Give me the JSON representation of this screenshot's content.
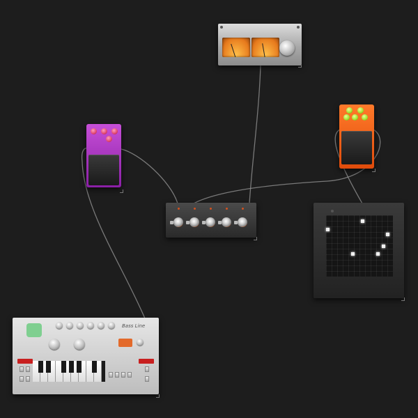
{
  "canvas": {
    "background": "#1d1d1d",
    "cable_color": "#8a8a8a"
  },
  "modules": {
    "vu_meter": {
      "icon": "vu-meter-icon",
      "meter_color": "#f08a24"
    },
    "pedal_purple": {
      "accent": "#b53bcc",
      "knob_color": "#e0466f"
    },
    "pedal_orange": {
      "accent": "#f26518",
      "knob_color": "#a3e12c"
    },
    "mixer": {
      "channel_count": 5,
      "knob_ring": "#b95a2a"
    },
    "xy_pad": {
      "dots": 6
    },
    "bass_line": {
      "title": "Bass Line",
      "accent": "#c81f1f"
    }
  }
}
